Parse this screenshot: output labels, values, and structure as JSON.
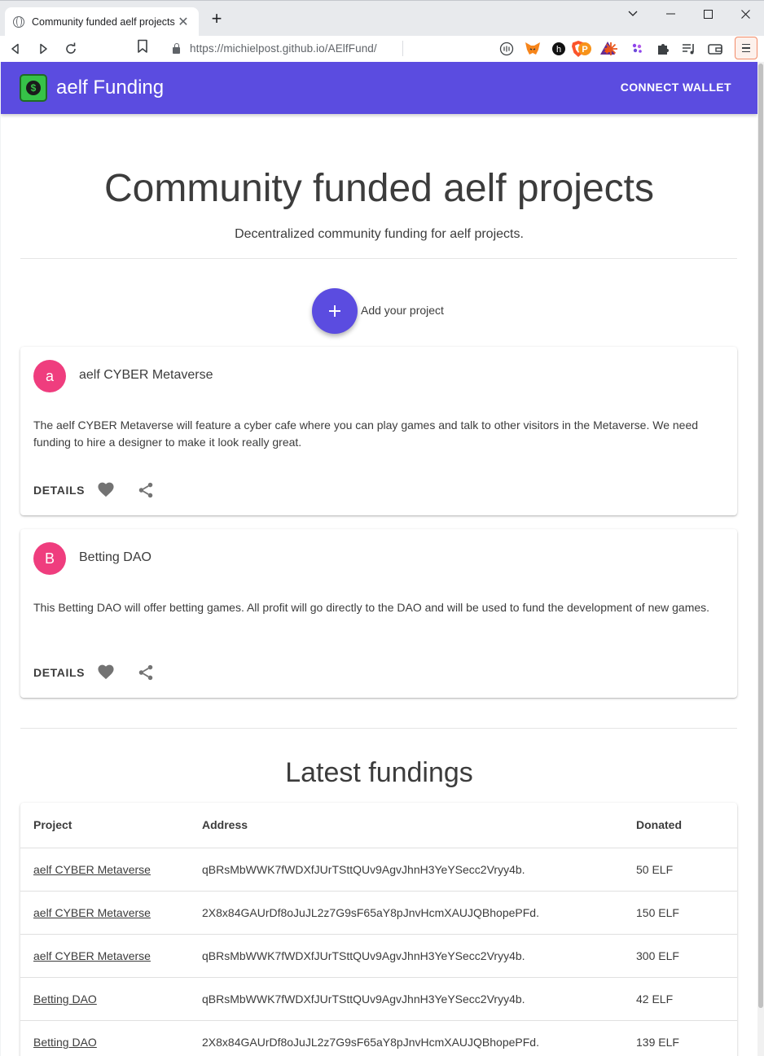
{
  "browser": {
    "tab_title": "Community funded aelf projects",
    "new_tab": "+",
    "url": "https://michielpost.github.io/AElfFund/"
  },
  "app": {
    "brand": "aelf Funding",
    "connect_wallet": "CONNECT WALLET",
    "accent_color": "#5b4ce0",
    "avatar_color": "#ef3d7e"
  },
  "hero": {
    "title": "Community funded aelf projects",
    "subtitle": "Decentralized community funding for aelf projects."
  },
  "add_project_label": "Add your project",
  "projects": [
    {
      "avatar_letter": "a",
      "title": "aelf CYBER Metaverse",
      "description": "The aelf CYBER Metaverse will feature a cyber cafe where you can play games and talk to other visitors in the Metaverse. We need funding to hire a designer to make it look really great.",
      "details_label": "DETAILS"
    },
    {
      "avatar_letter": "B",
      "title": "Betting DAO",
      "description": "This Betting DAO will offer betting games. All profit will go directly to the DAO and will be used to fund the development of new games.",
      "details_label": "DETAILS"
    }
  ],
  "latest": {
    "title": "Latest fundings",
    "columns": [
      "Project",
      "Address",
      "Donated"
    ],
    "rows": [
      {
        "project": "aelf CYBER Metaverse",
        "address": "qBRsMbWWK7fWDXfJUrTSttQUv9AgvJhnH3YeYSecc2Vryy4b.",
        "donated": "50 ELF"
      },
      {
        "project": "aelf CYBER Metaverse",
        "address": "2X8x84GAUrDf8oJuJL2z7G9sF65aY8pJnvHcmXAUJQBhopePFd.",
        "donated": "150 ELF"
      },
      {
        "project": "aelf CYBER Metaverse",
        "address": "qBRsMbWWK7fWDXfJUrTSttQUv9AgvJhnH3YeYSecc2Vryy4b.",
        "donated": "300 ELF"
      },
      {
        "project": "Betting DAO",
        "address": "qBRsMbWWK7fWDXfJUrTSttQUv9AgvJhnH3YeYSecc2Vryy4b.",
        "donated": "42 ELF"
      },
      {
        "project": "Betting DAO",
        "address": "2X8x84GAUrDf8oJuJL2z7G9sF65aY8pJnvHcmXAUJQBhopePFd.",
        "donated": "139 ELF"
      }
    ]
  },
  "icons": {
    "tab": "globe-icon",
    "back": "back-icon",
    "forward": "forward-icon",
    "reload": "reload-icon",
    "bookmark": "bookmark-icon",
    "lock": "lock-icon",
    "brave": "brave-shield-icon",
    "rewards": "brave-rewards-icon",
    "extensions": [
      "readaloud-icon",
      "metamask-icon",
      "hive-icon",
      "pepe-icon",
      "sparkle-icon",
      "dots-icon",
      "puzzle-icon",
      "playlist-icon",
      "wallet-icon"
    ],
    "menu": "menu-icon",
    "fab": "plus-icon",
    "favorite": "heart-icon",
    "share": "share-icon"
  }
}
